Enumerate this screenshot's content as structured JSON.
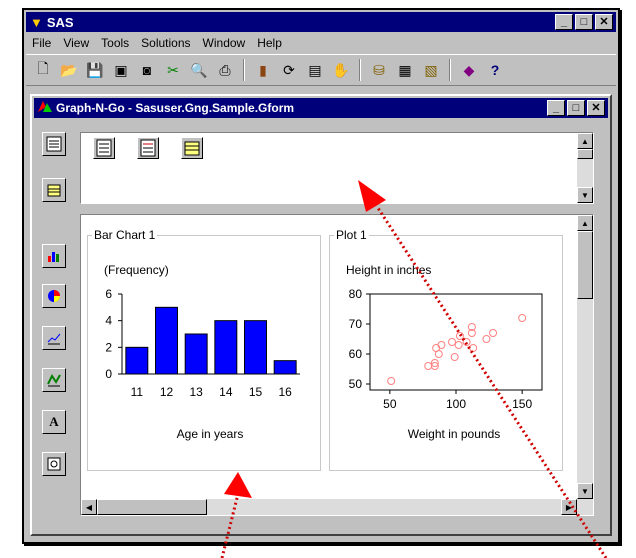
{
  "app": {
    "title": "SAS",
    "menu": [
      "File",
      "View",
      "Tools",
      "Solutions",
      "Window",
      "Help"
    ],
    "window_buttons": [
      "_",
      "□",
      "✕"
    ]
  },
  "child": {
    "title": "Graph-N-Go - Sasuser.Gng.Sample.Gform",
    "window_buttons": [
      "_",
      "□",
      "✕"
    ]
  },
  "colors": {
    "titlebar": "#00007b",
    "bars": "#0000ff",
    "points": "#ff8080",
    "arrow": "#d00000"
  },
  "bar_panel": {
    "label": "Bar Chart 1"
  },
  "plot_panel": {
    "label": "Plot 1"
  },
  "chart_data": [
    {
      "type": "bar",
      "categories": [
        "11",
        "12",
        "13",
        "14",
        "15",
        "16"
      ],
      "values": [
        2,
        5,
        3,
        4,
        4,
        1
      ],
      "ylabel": "(Frequency)",
      "xlabel": "Age in years",
      "yticks": [
        "0",
        "2",
        "4",
        "6"
      ],
      "ylim": [
        0,
        6
      ]
    },
    {
      "type": "scatter",
      "ylabel": "Height in inches",
      "xlabel": "Weight in pounds",
      "xticks": [
        "50",
        "100",
        "150"
      ],
      "yticks": [
        "50",
        "60",
        "70",
        "80"
      ],
      "xlim": [
        35,
        165
      ],
      "ylim": [
        48,
        80
      ],
      "points": [
        [
          51,
          51
        ],
        [
          79,
          56
        ],
        [
          84,
          56
        ],
        [
          84,
          57
        ],
        [
          85,
          62
        ],
        [
          87,
          60
        ],
        [
          89,
          63
        ],
        [
          97,
          64
        ],
        [
          99,
          59
        ],
        [
          102,
          63
        ],
        [
          103,
          66
        ],
        [
          108,
          64
        ],
        [
          112,
          67
        ],
        [
          112,
          69
        ],
        [
          113,
          62
        ],
        [
          123,
          65
        ],
        [
          128,
          67
        ],
        [
          150,
          72
        ]
      ]
    }
  ]
}
